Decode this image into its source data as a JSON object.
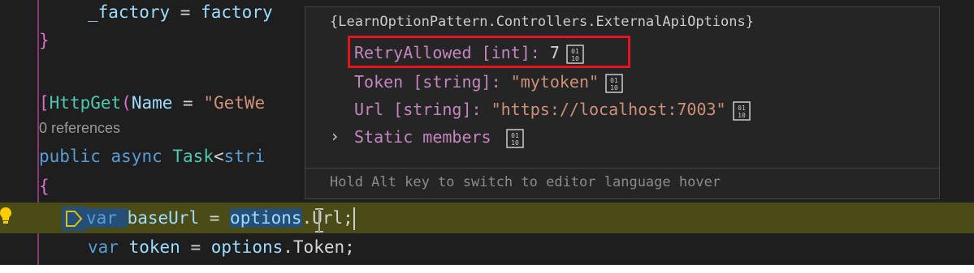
{
  "code": {
    "line1_lhs": "_factory",
    "line1_eq": " = ",
    "line1_rhs": "factory",
    "line2_brace": "}",
    "attr_open": "[",
    "attr_name": "HttpGet",
    "attr_paren": "(",
    "attr_param": "Name",
    "attr_eq": " = ",
    "attr_value": "\"GetWe",
    "references": "0 references",
    "sig_public": "public",
    "sig_async": "async",
    "sig_task": "Task",
    "sig_lt": "<",
    "sig_stri": "stri",
    "open_brace": "{",
    "line_var1_kw": "var",
    "line_var1_name": "baseUrl",
    "line_var1_eq": " = ",
    "line_var1_obj": "options",
    "line_var1_prop": ".Url;",
    "line_var2_kw": "var",
    "line_var2_name": "token",
    "line_var2_eq": " = ",
    "line_var2_obj": "options",
    "line_var2_prop": ".Token;"
  },
  "hover": {
    "title": "{LearnOptionPattern.Controllers.ExternalApiOptions}",
    "rows": [
      {
        "name": "RetryAllowed [int]:",
        "value": "7"
      },
      {
        "name": "Token [string]:",
        "value": "\"mytoken\""
      },
      {
        "name": "Url [string]:",
        "value": "\"https://localhost:7003\""
      }
    ],
    "static_members": "Static members",
    "footer": "Hold Alt key to switch to editor language hover"
  },
  "colors": {
    "editor_bg": "#1e1e1e",
    "keyword": "#569cd6",
    "type": "#4ec9b0",
    "string": "#ce9178",
    "highlight": "#e3141c"
  }
}
